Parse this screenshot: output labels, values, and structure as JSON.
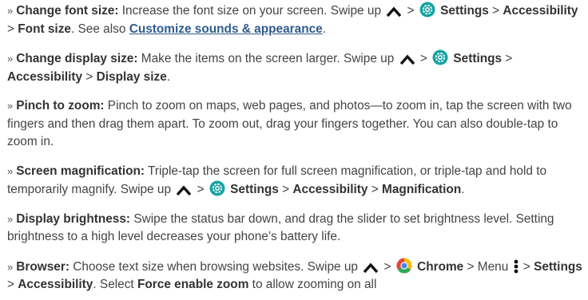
{
  "items": [
    {
      "bullet": "»",
      "title": "Change font size:",
      "t1": " Increase the font size on your screen. Swipe up ",
      "t2": " > ",
      "settings": "Settings",
      "t3": " > ",
      "accessibility": "Accessibility",
      "t4": " > ",
      "font_size": "Font size",
      "t5": ". See also ",
      "link": "Customize sounds & appearance",
      "t6": "."
    },
    {
      "bullet": "»",
      "title": "Change display size:",
      "t1": " Make the items on the screen larger. Swipe up ",
      "t2": " > ",
      "settings": "Settings",
      "t3": " > ",
      "accessibility": "Accessibility",
      "t4": " > ",
      "display_size": "Display size",
      "t5": "."
    },
    {
      "bullet": "»",
      "title": "Pinch to zoom:",
      "text": " Pinch to zoom on maps, web pages, and photos—to zoom in, tap the screen with two fingers and then drag them apart. To zoom out, drag your fingers together. You can also double-tap to zoom in."
    },
    {
      "bullet": "»",
      "title": "Screen magnification:",
      "t1": " Triple-tap the screen for full screen magnification, or triple-tap and hold to temporarily magnify. Swipe up ",
      "t2": " > ",
      "settings": "Settings",
      "t3": " > ",
      "accessibility": "Accessibility",
      "t4": " > ",
      "magnification": "Magnification",
      "t5": "."
    },
    {
      "bullet": "»",
      "title": "Display brightness:",
      "text": " Swipe the status bar down, and drag the slider to set brightness level. Setting brightness to a high level decreases your phone’s battery life."
    },
    {
      "bullet": "»",
      "title": "Browser:",
      "t1": " Choose text size when browsing websites. Swipe up ",
      "t2": " > ",
      "chrome": "Chrome",
      "t3": " > Menu ",
      "t4": " > ",
      "settings": "Settings",
      "t5": " > ",
      "accessibility": "Accessibility",
      "t6": ". Select ",
      "force_zoom": "Force enable zoom",
      "t7": " to allow zooming on all"
    }
  ],
  "icons": {
    "swipe_up": "chevron-up-icon",
    "settings": "gear-icon",
    "chrome": "chrome-icon",
    "menu": "vertical-dots-icon"
  },
  "colors": {
    "text": "#444444",
    "link": "#2f5b8b",
    "icon_teal": "#16a3a3"
  }
}
